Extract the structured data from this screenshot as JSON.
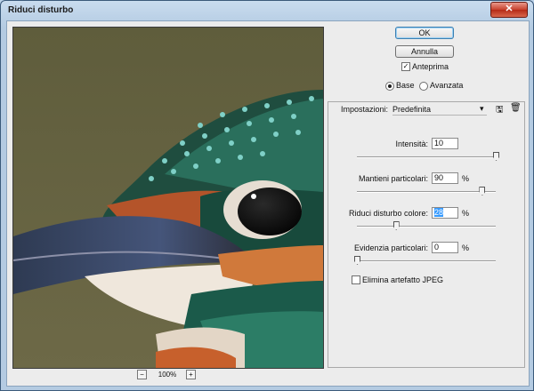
{
  "window": {
    "title": "Riduci disturbo",
    "close_glyph": "✕"
  },
  "buttons": {
    "ok": "OK",
    "cancel": "Annulla"
  },
  "preview_toggle": {
    "label": "Anteprima",
    "checked": true
  },
  "mode": {
    "base": "Base",
    "advanced": "Avanzata",
    "selected": "base"
  },
  "settings": {
    "label": "Impostazioni:",
    "value": "Predefinita"
  },
  "sliders": [
    {
      "label": "Intensità:",
      "value": "10",
      "unit": "",
      "fraction": 1.0
    },
    {
      "label": "Mantieni particolari:",
      "value": "90",
      "unit": "%",
      "fraction": 0.9
    },
    {
      "label": "Riduci disturbo colore:",
      "value": "28",
      "unit": "%",
      "fraction": 0.28
    },
    {
      "label": "Evidenzia particolari:",
      "value": "0",
      "unit": "%",
      "fraction": 0.0
    }
  ],
  "jpeg": {
    "label": "Elimina artefatto JPEG",
    "checked": false
  },
  "zoom": {
    "minus": "−",
    "plus": "+",
    "value": "100%"
  },
  "icons": {
    "save": "save-settings-icon",
    "delete": "delete-settings-icon",
    "menu": "dropdown-arrow-icon"
  }
}
